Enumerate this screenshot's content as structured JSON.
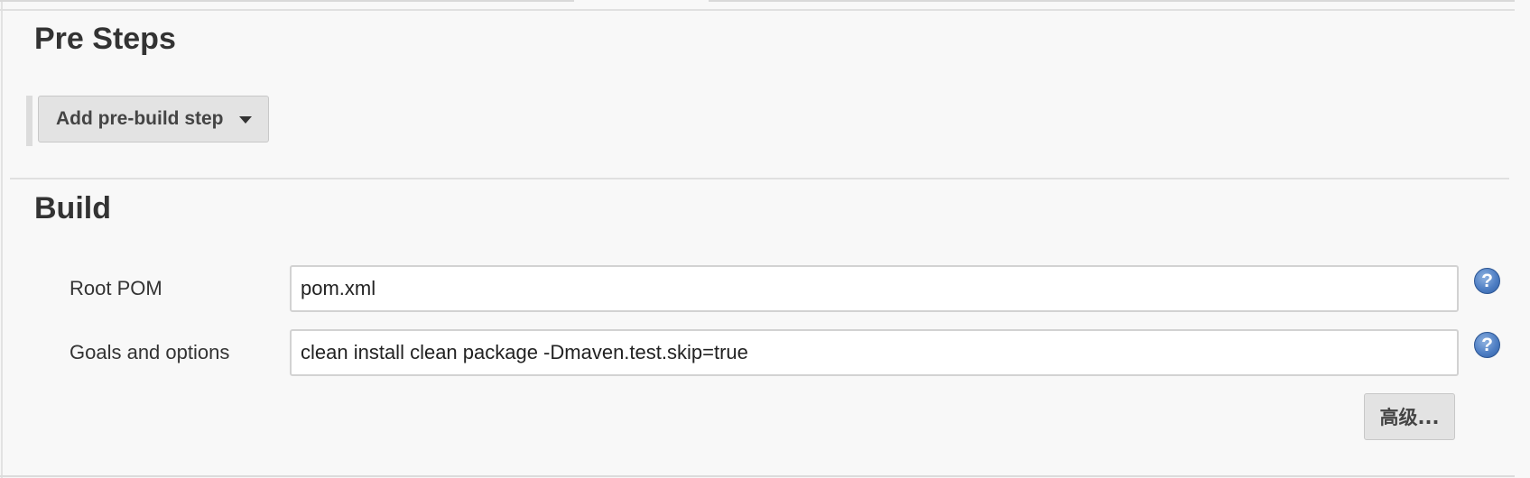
{
  "pre_steps": {
    "title": "Pre Steps",
    "add_step_label": "Add pre-build step"
  },
  "build": {
    "title": "Build",
    "root_pom": {
      "label": "Root POM",
      "value": "pom.xml"
    },
    "goals": {
      "label": "Goals and options",
      "value": "clean install clean package -Dmaven.test.skip=true"
    },
    "help_glyph": "?",
    "advanced_label": "高级..."
  },
  "icons": {
    "help": "help-icon",
    "dropdown": "caret-down-icon"
  },
  "colors": {
    "background": "#f8f8f8",
    "button_bg": "#e3e3e3",
    "help_blue": "#4f7fc4"
  }
}
